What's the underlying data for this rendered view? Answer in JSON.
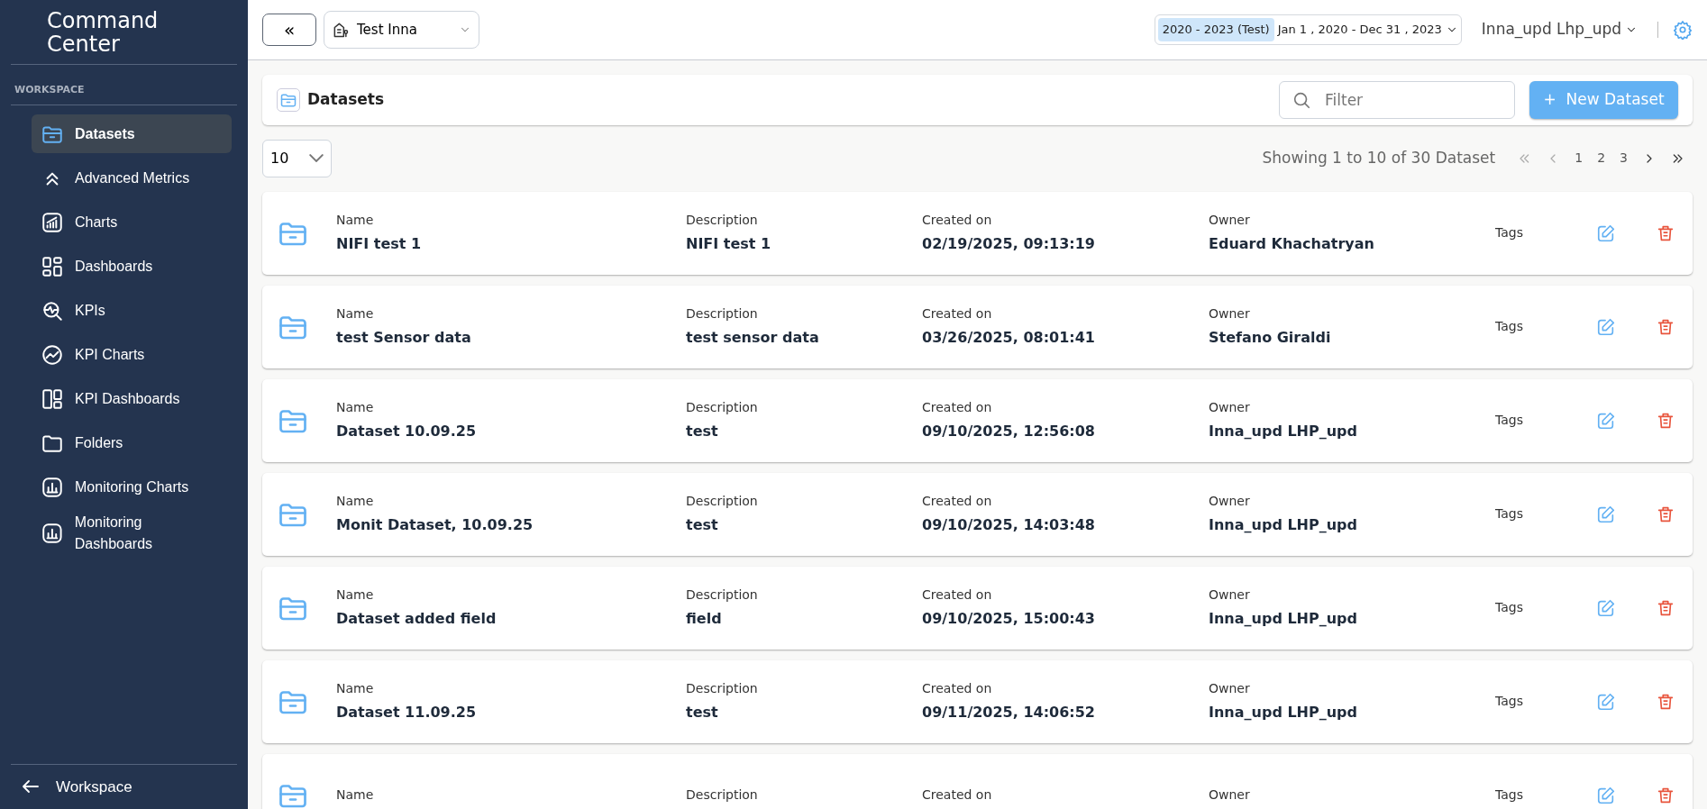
{
  "sidebar": {
    "title": "Command Center",
    "section": "WORKSPACE",
    "items": [
      {
        "label": "Datasets",
        "selected": true
      },
      {
        "label": "Advanced Metrics",
        "selected": false
      },
      {
        "label": "Charts",
        "selected": false
      },
      {
        "label": "Dashboards",
        "selected": false
      },
      {
        "label": "KPIs",
        "selected": false
      },
      {
        "label": "KPI Charts",
        "selected": false
      },
      {
        "label": "KPI Dashboards",
        "selected": false
      },
      {
        "label": "Folders",
        "selected": false
      },
      {
        "label": "Monitoring Charts",
        "selected": false
      },
      {
        "label": "Monitoring Dashboards",
        "selected": false
      }
    ],
    "footer": "Workspace"
  },
  "topbar": {
    "collapse": "«",
    "project": "Test Inna",
    "period_tag": "2020 - 2023 (Test)",
    "period_range": "Jan 1 , 2020 - Dec 31 , 2023",
    "user": "Inna_upd Lhp_upd"
  },
  "panel": {
    "title": "Datasets",
    "filter_placeholder": "Filter",
    "new_button": "+  New Dataset"
  },
  "pagination": {
    "page_size": "10",
    "summary": "Showing 1 to 10 of 30 Dataset",
    "pages": [
      {
        "label": "1",
        "selected": false
      },
      {
        "label": "2",
        "selected": false
      },
      {
        "label": "3",
        "selected": false
      }
    ]
  },
  "rows": [
    {
      "labels": [
        "Name",
        "Description",
        "Created on",
        "Owner",
        "Tags"
      ],
      "name": "NIFI test 1",
      "description": "NIFI test 1",
      "created": "02/19/2025, 09:13:19",
      "owner": "Eduard Khachatryan"
    },
    {
      "labels": [
        "Name",
        "Description",
        "Created on",
        "Owner",
        "Tags"
      ],
      "name": "test Sensor data",
      "description": "test sensor data",
      "created": "03/26/2025, 08:01:41",
      "owner": "Stefano Giraldi"
    },
    {
      "labels": [
        "Name",
        "Description",
        "Created on",
        "Owner",
        "Tags"
      ],
      "name": "Dataset 10.09.25",
      "description": "test",
      "created": "09/10/2025, 12:56:08",
      "owner": "Inna_upd LHP_upd"
    },
    {
      "labels": [
        "Name",
        "Description",
        "Created on",
        "Owner",
        "Tags"
      ],
      "name": "Monit Dataset, 10.09.25",
      "description": "test",
      "created": "09/10/2025, 14:03:48",
      "owner": "Inna_upd LHP_upd"
    },
    {
      "labels": [
        "Name",
        "Description",
        "Created on",
        "Owner",
        "Tags"
      ],
      "name": "Dataset added field",
      "description": "field",
      "created": "09/10/2025, 15:00:43",
      "owner": "Inna_upd LHP_upd"
    },
    {
      "labels": [
        "Name",
        "Description",
        "Created on",
        "Owner",
        "Tags"
      ],
      "name": "Dataset 11.09.25",
      "description": "test",
      "created": "09/11/2025, 14:06:52",
      "owner": "Inna_upd LHP_upd"
    },
    {
      "labels": [
        "Name",
        "Description",
        "Created on",
        "Owner",
        "Tags"
      ]
    }
  ]
}
